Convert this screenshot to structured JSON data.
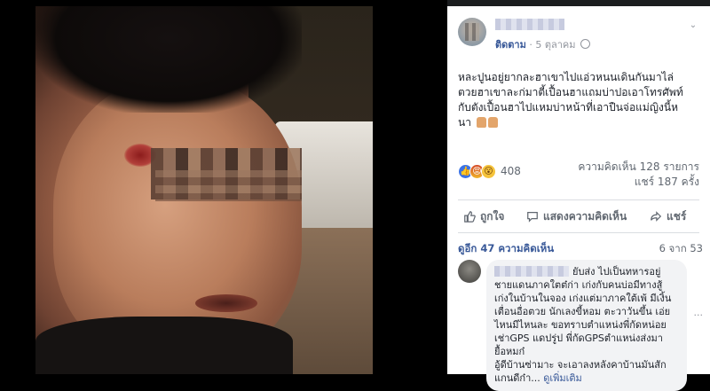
{
  "post": {
    "author_name": "",
    "follow_label": "ติดตาม",
    "separator": "·",
    "date": "5 ตุลาคม",
    "privacy_icon": "globe-icon",
    "text_line1": "หละปูนอยู่ยากละฮาเขาไปแอ่วหนนเดินกันมาไล่",
    "text_line2": "ตวยฮาเขาละก่มาตี้เปื้อนฮาแถมบ่าปอเอาโทรศัพท์",
    "text_line3": "กับตังเปื้อนฮาไปแหมบ่าหน้าที่เอาปืนจ่อแม่ญิงนี้ห",
    "text_line4": "นา"
  },
  "reactions": {
    "types": [
      "like",
      "angry",
      "wow"
    ],
    "count": "408",
    "comments_label": "ความคิดเห็น 128 รายการ",
    "shares_label": "แชร์ 187 ครั้ง"
  },
  "actions": {
    "like_label": "ถูกใจ",
    "comment_label": "แสดงความคิดเห็น",
    "share_label": "แชร์"
  },
  "comments_header": {
    "more_label": "ดูอีก 47 ความคิดเห็น",
    "pages_label": "6 จาก 53"
  },
  "comment": {
    "author_name": "",
    "line1": "ยับส่ง ไปเป็นทหารอยู่",
    "line2": "ชายแดนภาคใตต๋ก่า เก่งกับคนบ่อมีทางสู้",
    "line3": "เก่งในบ้านในจอง เก่งแต่มาภาคใต้เพ้ มีเงิ้น",
    "line4": "เตื่อนอื่อตวย นักเลงขี้หอม ตะวาวันขึ้น เอ่ย",
    "line5": "ไหนมีไหนละ ขอทราบตำแหน่งพี่กัดหน่อย",
    "line6": "เช่าGPS แดปรู่ป พี่กัดGPSตำแหน่งส่งมา",
    "line7": "ยื้อหมก๋",
    "line8": "อู้ดีบ้านซ่ามาะ จะเอาลงหลังคาบ้านมันสัก",
    "line9": "แกนดีก๋า...",
    "see_more": "ดูเพิ่มเติม"
  },
  "colors": {
    "link_blue": "#385898",
    "text": "#1d2129",
    "muted": "#606770",
    "like_blue": "#3b73e6"
  }
}
